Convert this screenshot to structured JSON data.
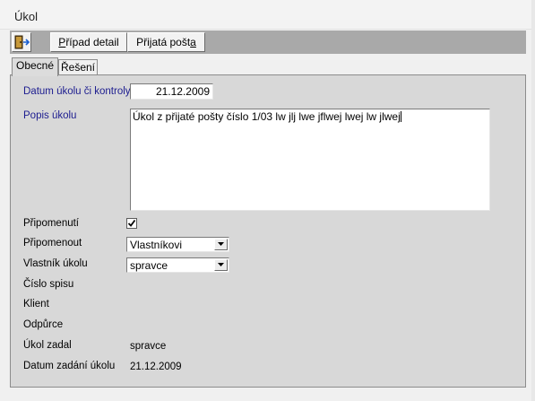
{
  "window": {
    "title": "Úkol"
  },
  "toolbar": {
    "exit_icon": "exit-door-icon",
    "case_detail": {
      "pre": "",
      "accel": "P",
      "post": "řípad detail"
    },
    "received_mail": {
      "pre": "Přijatá pošt",
      "accel": "a",
      "post": ""
    },
    "bg_color": "#a9a9a9"
  },
  "tabs": [
    {
      "label": "Obecné",
      "active": true
    },
    {
      "label": "Řešení",
      "active": false
    }
  ],
  "form": {
    "task_date_label": "Datum úkolu či kontroly",
    "task_date_value": "21.12.2009",
    "description_label": "Popis úkolu",
    "description_value": "Úkol z přijaté pošty číslo 1/03 lw jlj lwe jflwej lwej lw jlwej",
    "remind_label": "Připomenutí",
    "remind_checked": true,
    "remind_to_label": "Připomenout",
    "remind_to_value": "Vlastníkovi",
    "owner_label": "Vlastník úkolu",
    "owner_value": "spravce",
    "file_no_label": "Číslo spisu",
    "client_label": "Klient",
    "opponent_label": "Odpůrce",
    "assigned_by_label": "Úkol zadal",
    "assigned_by_value": "spravce",
    "assigned_date_label": "Datum zadání úkolu",
    "assigned_date_value": "21.12.2009",
    "label_blue_color": "#1c1c8f"
  }
}
